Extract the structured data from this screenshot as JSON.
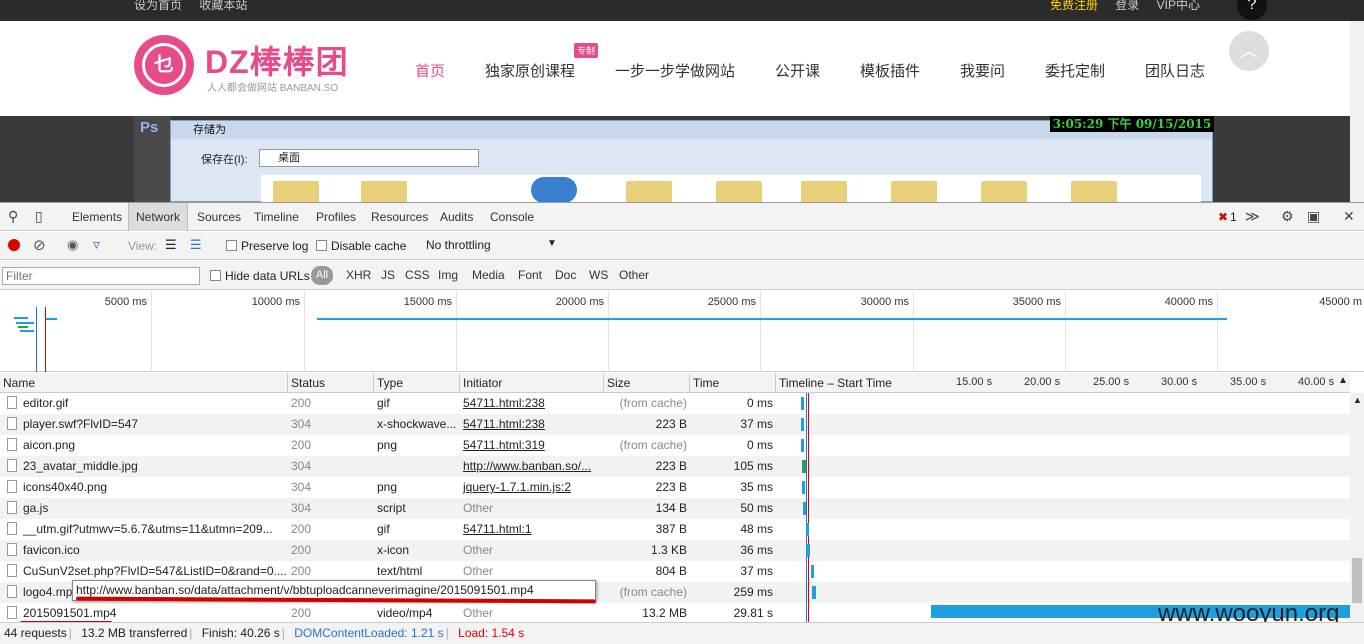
{
  "site": {
    "top_left": [
      "设为首页",
      "收藏本站"
    ],
    "top_right": {
      "free": "免费注册",
      "login": "登录",
      "vip": "VIP中心"
    },
    "help_icon": "?",
    "logo_mark": "乜",
    "logo_text": "DZ棒棒团",
    "logo_sub": "人人都会做网站 BANBAN.SO",
    "nav": [
      "首页",
      "独家原创课程",
      "一步一步学做网站",
      "公开课",
      "模板插件",
      "我要问",
      "委托定制",
      "团队日志"
    ],
    "nav_badge": "专制",
    "accent": "#e84b8a",
    "scroll_top_icon": "︿"
  },
  "video": {
    "ps_label": "Ps",
    "dialog_title": "存储为",
    "save_in_label": "保存在(I):",
    "save_in_value": "桌面",
    "clock": "3:05:29 下午 09/15/2015"
  },
  "devtools": {
    "tabs": [
      "Elements",
      "Network",
      "Sources",
      "Timeline",
      "Profiles",
      "Resources",
      "Audits",
      "Console"
    ],
    "active_tab": "Network",
    "error_count": "1",
    "toolbar": {
      "view_label": "View:",
      "preserve_log": "Preserve log",
      "disable_cache": "Disable cache",
      "throttling": "No throttling"
    },
    "filter": {
      "placeholder": "Filter",
      "hide_data_urls": "Hide data URLs",
      "all": "All",
      "types": [
        "XHR",
        "JS",
        "CSS",
        "Img",
        "Media",
        "Font",
        "Doc",
        "WS",
        "Other"
      ]
    },
    "overview_ticks": [
      "5000 ms",
      "10000 ms",
      "15000 ms",
      "20000 ms",
      "25000 ms",
      "30000 ms",
      "35000 ms",
      "40000 ms",
      "45000 m"
    ],
    "columns": [
      "Name",
      "Status",
      "Type",
      "Initiator",
      "Size",
      "Time",
      "Timeline – Start Time"
    ],
    "timeline_ticks": [
      "15.00 s",
      "20.00 s",
      "25.00 s",
      "30.00 s",
      "35.00 s",
      "40.00 s"
    ],
    "rows": [
      {
        "name": "editor.gif",
        "status": "200",
        "type": "gif",
        "initiator": "54711.html:238",
        "size": "(from cache)",
        "time": "0 ms",
        "bar_start_s": 0.9,
        "bar_len_s": 0.15,
        "color": "#1e9fe0"
      },
      {
        "name": "player.swf?FlvID=547",
        "status": "304",
        "type": "x-shockwave...",
        "initiator": "54711.html:238",
        "size": "223 B",
        "time": "37 ms",
        "bar_start_s": 0.9,
        "bar_len_s": 0.15,
        "color": "#1e9fe0"
      },
      {
        "name": "aicon.png",
        "status": "200",
        "type": "png",
        "initiator": "54711.html:319",
        "size": "(from cache)",
        "time": "0 ms",
        "bar_start_s": 0.9,
        "bar_len_s": 0.15,
        "color": "#1e9fe0"
      },
      {
        "name": "23_avatar_middle.jpg",
        "status": "304",
        "type": "",
        "initiator": "http://www.banban.so/...",
        "size": "223 B",
        "time": "105 ms",
        "bar_start_s": 0.95,
        "bar_len_s": 0.2,
        "color": "#2a9d64"
      },
      {
        "name": "icons40x40.png",
        "status": "304",
        "type": "png",
        "initiator": "jquery-1.7.1.min.js:2",
        "size": "223 B",
        "time": "35 ms",
        "bar_start_s": 1.0,
        "bar_len_s": 0.15,
        "color": "#1e9fe0"
      },
      {
        "name": "ga.js",
        "status": "304",
        "type": "script",
        "initiator": "Other",
        "size": "134 B",
        "time": "50 ms",
        "bar_start_s": 1.05,
        "bar_len_s": 0.15,
        "color": "#1e9fe0"
      },
      {
        "name": "__utm.gif?utmwv=5.6.7&utms=11&utmn=209...",
        "status": "200",
        "type": "gif",
        "initiator": "54711.html:1",
        "size": "387 B",
        "time": "48 ms",
        "bar_start_s": 1.25,
        "bar_len_s": 0.15,
        "color": "#1e9fe0"
      },
      {
        "name": "favicon.ico",
        "status": "200",
        "type": "x-icon",
        "initiator": "Other",
        "size": "1.3 KB",
        "time": "36 ms",
        "bar_start_s": 1.3,
        "bar_len_s": 0.15,
        "color": "#1e9fe0"
      },
      {
        "name": "CuSunV2set.php?FlvID=547&ListID=0&rand=0....",
        "status": "200",
        "type": "text/html",
        "initiator": "Other",
        "size": "804 B",
        "time": "37 ms",
        "bar_start_s": 1.6,
        "bar_len_s": 0.15,
        "color": "#1e9fe0"
      },
      {
        "name": "logo4.mp",
        "status": "",
        "type": "",
        "initiator": "",
        "size": "(from cache)",
        "time": "259 ms",
        "bar_start_s": 1.7,
        "bar_len_s": 0.2,
        "color": "#1e9fe0"
      },
      {
        "name": "2015091501.mp4",
        "status": "200",
        "type": "video/mp4",
        "initiator": "Other",
        "size": "13.2 MB",
        "time": "29.81 s",
        "bar_start_s": 11.0,
        "bar_len_s": 29.81,
        "color": "#1e9fe0"
      }
    ],
    "tooltip": "http://www.banban.so/data/attachment/v/bbtuploadcanneverimagine/2015091501.mp4",
    "status": {
      "requests": "44 requests",
      "transferred": "13.2 MB transferred",
      "finish": "Finish: 40.26 s",
      "dcl": "DOMContentLoaded: 1.21 s",
      "load": "Load: 1.54 s"
    }
  },
  "watermark": "www.wooyun.org"
}
